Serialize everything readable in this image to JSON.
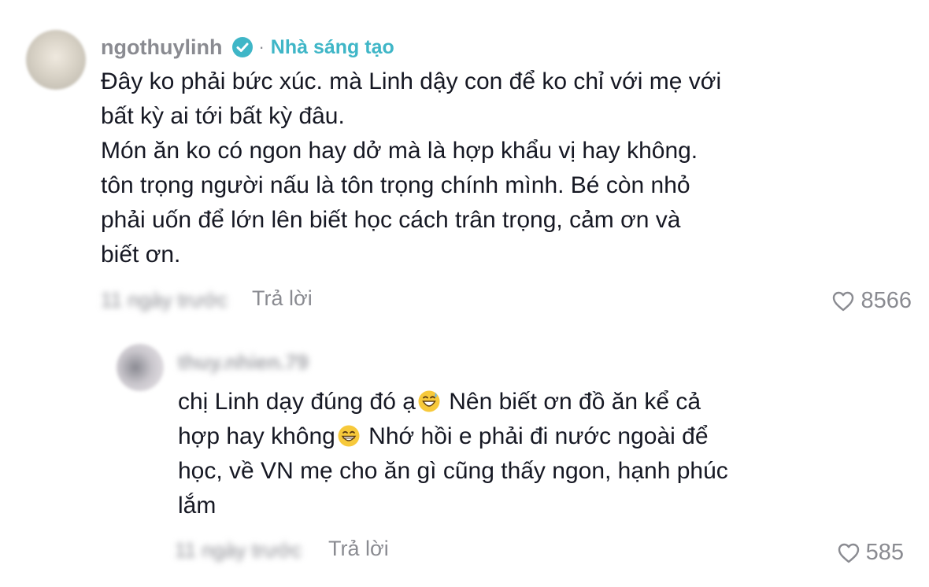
{
  "main_comment": {
    "username": "ngothuylinh",
    "separator": "·",
    "creator_badge": "Nhà sáng tạo",
    "text_lines": [
      "Đây ko phải bức xúc. mà Linh dậy con để ko chỉ với mẹ với",
      "bất kỳ ai tới bất kỳ đâu.",
      "Món ăn ko có ngon hay dở mà là hợp khẩu vị hay không.",
      "tôn trọng người nấu là tôn trọng chính mình. Bé còn nhỏ",
      "phải uốn để lớn lên biết học cách trân trọng, cảm ơn và",
      "biết ơn."
    ],
    "meta_blurred": "11 ngày trước",
    "reply_label": "Trả lời",
    "likes": "8566"
  },
  "reply_comment": {
    "username_blurred": "thuy.nhien.79",
    "text_parts": {
      "p1": "chị Linh dạy đúng đó ạ",
      "p2": " Nên biết ơn đồ ăn kể cả",
      "p3": "hợp hay không",
      "p4": " Nhớ hồi e phải đi nước ngoài để",
      "p5": "học, về VN mẹ cho ăn gì cũng thấy ngon, hạnh phúc",
      "p6": "lắm"
    },
    "emoji_1": "grinning-sweat-emoji",
    "emoji_2": "grinning-emoji",
    "meta_blurred": "11 ngày trước",
    "reply_label": "Trả lời",
    "likes": "585"
  },
  "colors": {
    "text": "#161823",
    "muted": "#8a8b91",
    "verified": "#3fb6c7",
    "creator": "#3fb6c7"
  }
}
